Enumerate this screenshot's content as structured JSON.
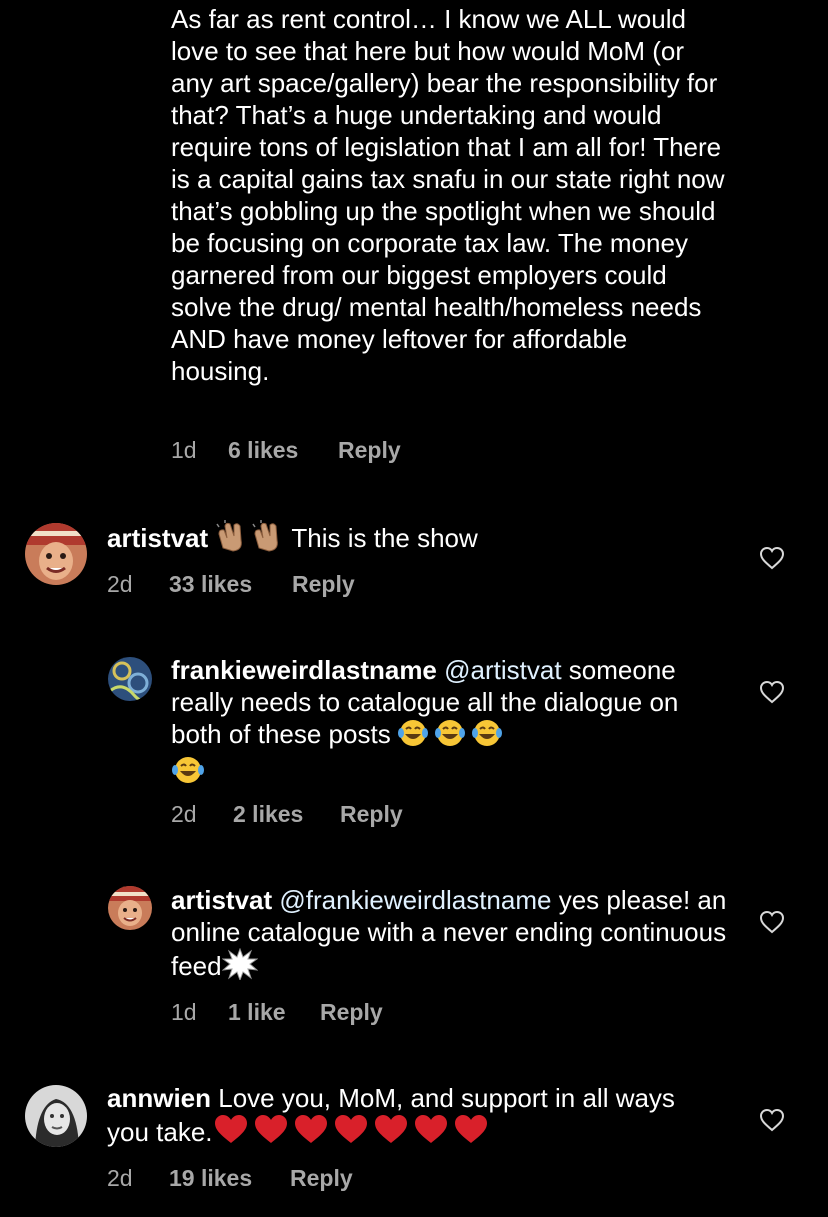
{
  "thread": {
    "top_comment": {
      "text": "As far as rent control… I know we ALL would love to see that here but how would MoM (or any art space/gallery) bear the responsibility for that? That’s a huge undertaking and would require tons of legislation that I am all for! There is a capital gains tax snafu in our state right now that’s gobbling up the spotlight when we should be focusing on corporate tax law. The money garnered from our biggest employers could solve the drug/ mental health/homeless needs AND have money leftover for affordable housing.",
      "time": "1d",
      "likes": "6 likes",
      "reply": "Reply"
    },
    "comments": [
      {
        "username": "artistvat",
        "text": "This is the show",
        "emoji": "clapping-hands x2",
        "time": "2d",
        "likes": "33 likes",
        "reply": "Reply"
      },
      {
        "username": "frankieweirdlastname",
        "mention": "@artistvat",
        "text": "someone really needs to catalogue all the dialogue on both of these posts",
        "emoji": "tears-of-joy x4",
        "time": "2d",
        "likes": "2 likes",
        "reply": "Reply"
      },
      {
        "username": "artistvat",
        "mention": "@frankieweirdlastname",
        "text": "yes please! an online catalogue with a never ending continuous feed",
        "emoji": "explosion",
        "time": "1d",
        "likes": "1 like",
        "reply": "Reply"
      },
      {
        "username": "annwien",
        "text": "Love you, MoM, and support in all ways you take.",
        "emoji": "red-heart x7",
        "time": "2d",
        "likes": "19 likes",
        "reply": "Reply"
      }
    ]
  },
  "colors": {
    "background": "#000000",
    "text": "#ffffff",
    "secondary": "#a8a8a8",
    "mention": "#e0f1ff"
  },
  "icons": [
    "heart-outline-icon",
    "clapping-hands-emoji",
    "tears-of-joy-emoji",
    "explosion-emoji",
    "red-heart-emoji"
  ]
}
